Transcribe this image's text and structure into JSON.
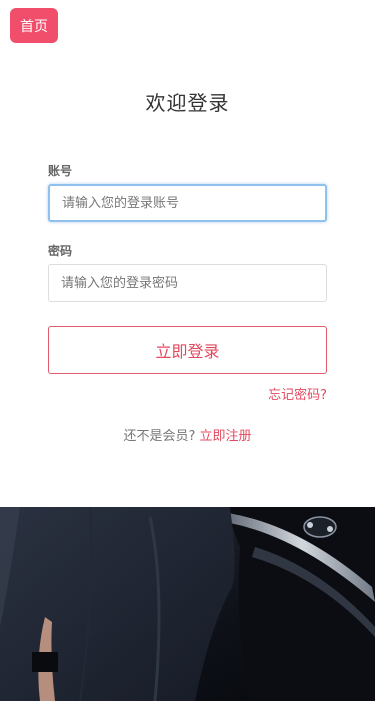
{
  "header": {
    "home_label": "首页"
  },
  "login": {
    "title": "欢迎登录",
    "account_label": "账号",
    "account_placeholder": "请输入您的登录账号",
    "account_value": "",
    "password_label": "密码",
    "password_placeholder": "请输入您的登录密码",
    "password_value": "",
    "submit_label": "立即登录",
    "forgot_label": "忘记密码?",
    "register_prompt": "还不是会员?",
    "register_link": "立即注册"
  },
  "colors": {
    "accent": "#f04e6a",
    "link": "#e34a60",
    "focus_border": "#8fc1ec"
  }
}
